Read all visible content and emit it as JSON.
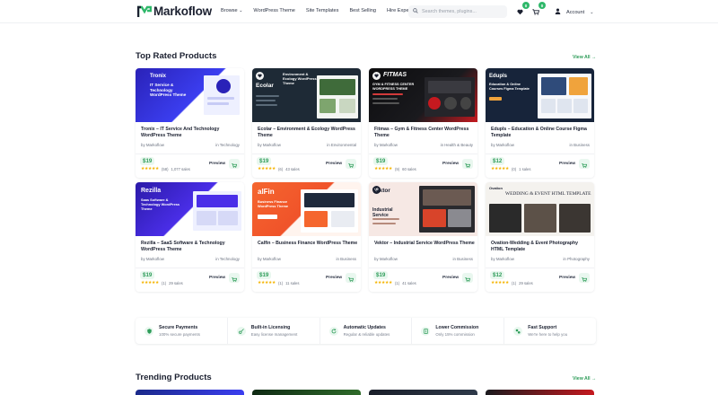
{
  "header": {
    "logo": "Markoflow",
    "nav": [
      "Browse",
      "WordPress Theme",
      "Site Templates",
      "Best Selling",
      "Hire Expert"
    ],
    "search_placeholder": "Search themes, plugins...",
    "wishlist_count": "0",
    "cart_count": "0",
    "account_label": "Account"
  },
  "top_rated": {
    "title": "Top Rated Products",
    "view_all": "View All →",
    "products": [
      {
        "title": "Tronix – IT Service And Technology WordPress Theme",
        "author": "by Markoflow",
        "category": "in Technology",
        "price": "$19",
        "stars": "★★★★★",
        "rating": "(58)",
        "sales": "1,077 sales",
        "thumb_label": "Tronix",
        "thumb_sub": "IT Service & Technology WordPress Theme"
      },
      {
        "title": "Ecolar – Environment & Ecology WordPress Theme",
        "author": "by Markoflow",
        "category": "in Environmental",
        "price": "$19",
        "stars": "★★★★★",
        "rating": "(6)",
        "sales": "43 sales",
        "thumb_label": "Ecolar",
        "thumb_sub": "Environment & Ecology WordPress Theme"
      },
      {
        "title": "Fitmas – Gym & Fitness Center WordPress Theme",
        "author": "by Markoflow",
        "category": "in Health & Beauty",
        "price": "$19",
        "stars": "★★★★★",
        "rating": "(9)",
        "sales": "60 sales",
        "thumb_label": "FITMAS",
        "thumb_sub": "GYM & FITNESS CENTER WORDPRESS THEME"
      },
      {
        "title": "Edupls – Education & Online Course Figma Template",
        "author": "by Markoflow",
        "category": "in Business",
        "price": "$12",
        "stars": "★★★★★",
        "rating": "(0)",
        "sales": "1 sales",
        "thumb_label": "Edupls",
        "thumb_sub": "Education & Online Courses Figma Template"
      },
      {
        "title": "Rezilla – SaaS Software & Technology WordPress Theme",
        "author": "by Markoflow",
        "category": "in Technology",
        "price": "$19",
        "stars": "★★★★★",
        "rating": "(1)",
        "sales": "29 sales",
        "thumb_label": "Rezilla",
        "thumb_sub": "Saas Software & Technology WordPress Theme"
      },
      {
        "title": "Calfin – Business Finance WordPress Theme",
        "author": "by Markoflow",
        "category": "in Business",
        "price": "$19",
        "stars": "★★★★★",
        "rating": "(1)",
        "sales": "11 sales",
        "thumb_label": "alFin",
        "thumb_sub": "Business Finance WordPress Theme"
      },
      {
        "title": "Vektor – Industrial Service WordPress Theme",
        "author": "by Markoflow",
        "category": "in Business",
        "price": "$19",
        "stars": "★★★★★",
        "rating": "(1)",
        "sales": "41 sales",
        "thumb_label": "Vektor",
        "thumb_sub": "Industrial Service"
      },
      {
        "title": "Ovation-Wedding & Event Photography HTML Template",
        "author": "by Markoflow",
        "category": "in Photography",
        "price": "$12",
        "stars": "★★★★★",
        "rating": "(1)",
        "sales": "29 sales",
        "thumb_label": "WEDDING & EVENT HTML TEMPLATE",
        "thumb_sub": "Ovation"
      }
    ],
    "preview_label": "Preview"
  },
  "features": [
    {
      "title": "Secure Payments",
      "sub": "100% secure payments",
      "icon": "shield-icon"
    },
    {
      "title": "Built-in Licensing",
      "sub": "Easy license management",
      "icon": "key-icon"
    },
    {
      "title": "Automatic Updates",
      "sub": "Regular & reliable updates",
      "icon": "refresh-icon"
    },
    {
      "title": "Lower Commission",
      "sub": "Only 15% commission",
      "icon": "dollar-icon"
    },
    {
      "title": "Fast Support",
      "sub": "We're here to help you",
      "icon": "support-icon"
    }
  ],
  "trending": {
    "title": "Trending Products",
    "view_all": "View All →"
  },
  "colors": {
    "accent": "#2f9d5a",
    "accent_bg": "#e9f7ef",
    "star": "#f5b400"
  }
}
